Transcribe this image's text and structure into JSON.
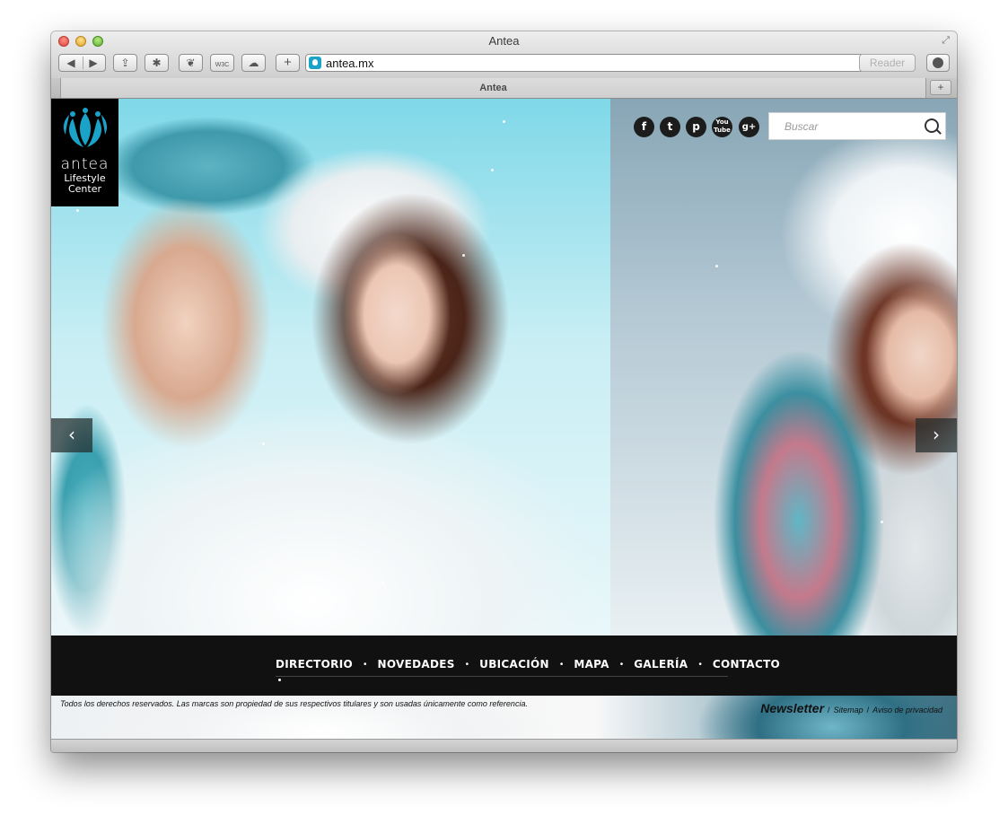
{
  "window": {
    "title": "Antea"
  },
  "toolbar": {
    "back_icon": "◀",
    "forward_icon": "▶",
    "share_icon": "⇪",
    "bug_icon": "✱",
    "leaf_icon": "❦",
    "w3c_label": "W3C",
    "cloud_icon": "☁",
    "add_icon": "+",
    "url": "antea.mx",
    "reload_icon": "↻",
    "reader_label": "Reader"
  },
  "tabs": {
    "active_label": "Antea",
    "new_tab_icon": "+"
  },
  "logo": {
    "line1": "antea",
    "line2": "Lifestyle",
    "line3": "Center"
  },
  "social": {
    "facebook": "f",
    "twitter": "t",
    "pinterest": "p",
    "youtube_top": "You",
    "youtube_bottom": "Tube",
    "googleplus": "g+"
  },
  "search": {
    "placeholder": "Buscar"
  },
  "slider": {
    "prev_icon": "‹",
    "next_icon": "›"
  },
  "nav": {
    "items": [
      "DIRECTORIO",
      "NOVEDADES",
      "UBICACIÓN",
      "MAPA",
      "GALERÍA",
      "CONTACTO"
    ],
    "separator": "•"
  },
  "footer": {
    "copyright": "Todos los derechos reservados. Las marcas son propiedad de sus respectivos titulares y son usadas únicamente como referencia.",
    "newsletter": "Newsletter",
    "separator": "/",
    "sitemap": "Sitemap",
    "privacy": "Aviso de privacidad"
  },
  "colors": {
    "accent": "#1ba2c8",
    "nav_bg": "#111111",
    "logo_bg": "#000000"
  }
}
